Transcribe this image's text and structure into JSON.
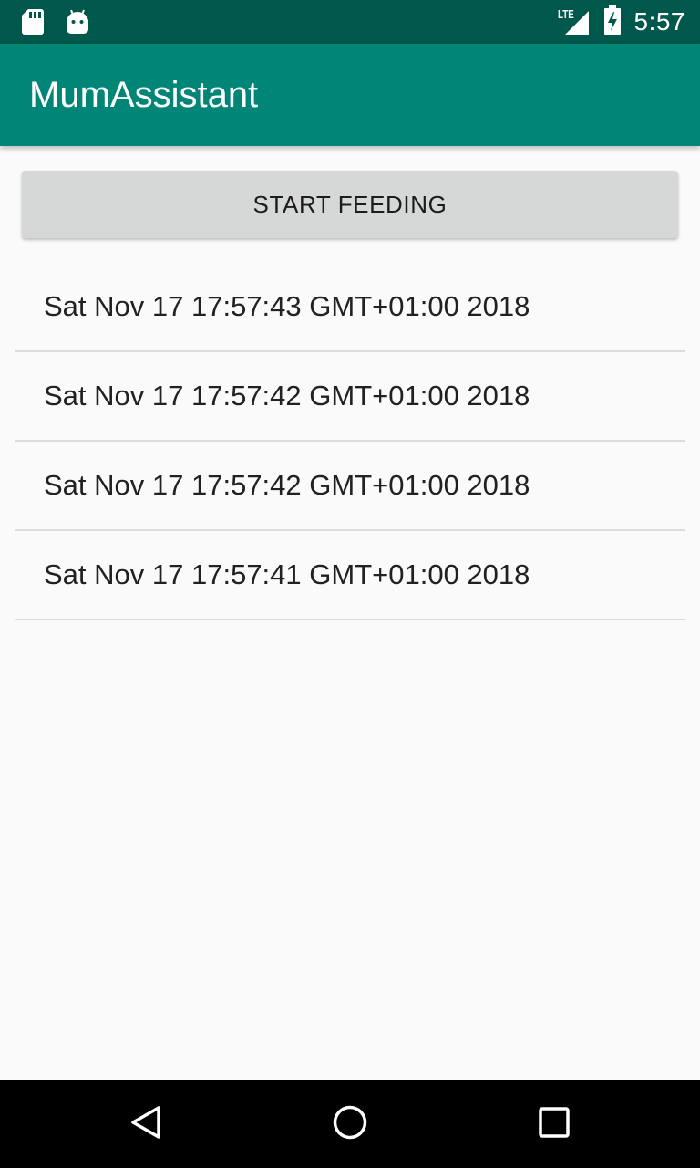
{
  "status_bar": {
    "time": "5:57",
    "network": "LTE",
    "icons": [
      "sd-card-icon",
      "android-icon",
      "lte-signal-icon",
      "battery-charging-icon"
    ]
  },
  "app_bar": {
    "title": "MumAssistant"
  },
  "main": {
    "start_button_label": "START FEEDING",
    "feedings": [
      "Sat Nov 17 17:57:43 GMT+01:00 2018",
      "Sat Nov 17 17:57:42 GMT+01:00 2018",
      "Sat Nov 17 17:57:42 GMT+01:00 2018",
      "Sat Nov 17 17:57:41 GMT+01:00 2018"
    ]
  },
  "nav_bar": {
    "icons": [
      "back-icon",
      "home-icon",
      "recents-icon"
    ]
  },
  "colors": {
    "status_bar": "#00574b",
    "app_bar": "#008577",
    "button": "#d6d7d7",
    "background": "#fafafa"
  }
}
